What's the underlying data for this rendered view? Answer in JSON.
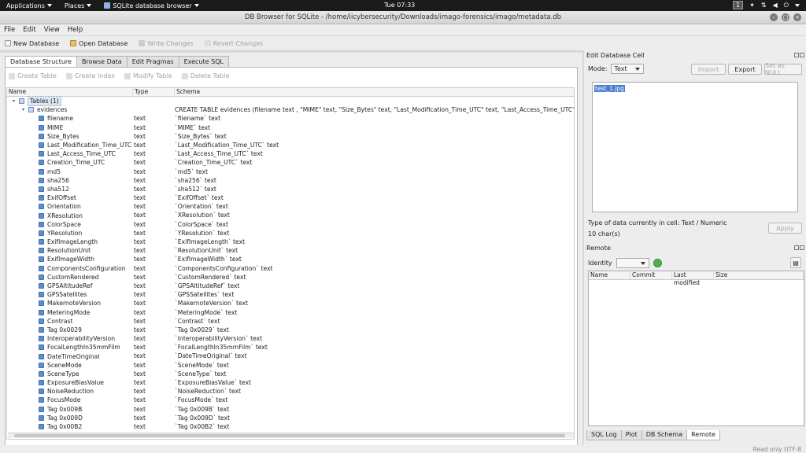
{
  "system_bar": {
    "applications": "Applications",
    "places": "Places",
    "active_app": "SQLite database browser",
    "clock": "Tue 07:33",
    "workspace": "1"
  },
  "window": {
    "title": "DB Browser for SQLite - /home/iicybersecurity/Downloads/imago-forensics/imago/metadata.db"
  },
  "menu": [
    "File",
    "Edit",
    "View",
    "Help"
  ],
  "toolbar": {
    "new_db": "New Database",
    "open_db": "Open Database",
    "write": "Write Changes",
    "revert": "Revert Changes"
  },
  "tabs": [
    "Database Structure",
    "Browse Data",
    "Edit Pragmas",
    "Execute SQL"
  ],
  "structure_toolbar": [
    "Create Table",
    "Create Index",
    "Modify Table",
    "Delete Table"
  ],
  "tree": {
    "headers": [
      "Name",
      "Type",
      "Schema"
    ],
    "tables_node": "Tables (1)",
    "table": {
      "name": "evidences",
      "schema": "CREATE TABLE evidences (filename text , \"MIME\" text, \"Size_Bytes\" text, \"Last_Modification_Time_UTC\" text, \"Last_Access_Time_UTC\" tex"
    },
    "fields": [
      {
        "name": "filename",
        "type": "text",
        "schema": "`filename` text"
      },
      {
        "name": "MIME",
        "type": "text",
        "schema": "`MIME` text"
      },
      {
        "name": "Size_Bytes",
        "type": "text",
        "schema": "`Size_Bytes` text"
      },
      {
        "name": "Last_Modification_Time_UTC",
        "type": "text",
        "schema": "`Last_Modification_Time_UTC` text"
      },
      {
        "name": "Last_Access_Time_UTC",
        "type": "text",
        "schema": "`Last_Access_Time_UTC` text"
      },
      {
        "name": "Creation_Time_UTC",
        "type": "text",
        "schema": "`Creation_Time_UTC` text"
      },
      {
        "name": "md5",
        "type": "text",
        "schema": "`md5` text"
      },
      {
        "name": "sha256",
        "type": "text",
        "schema": "`sha256` text"
      },
      {
        "name": "sha512",
        "type": "text",
        "schema": "`sha512` text"
      },
      {
        "name": "ExifOffset",
        "type": "text",
        "schema": "`ExifOffset` text"
      },
      {
        "name": "Orientation",
        "type": "text",
        "schema": "`Orientation` text"
      },
      {
        "name": "XResolution",
        "type": "text",
        "schema": "`XResolution` text"
      },
      {
        "name": "ColorSpace",
        "type": "text",
        "schema": "`ColorSpace` text"
      },
      {
        "name": "YResolution",
        "type": "text",
        "schema": "`YResolution` text"
      },
      {
        "name": "ExifImageLength",
        "type": "text",
        "schema": "`ExifImageLength` text"
      },
      {
        "name": "ResolutionUnit",
        "type": "text",
        "schema": "`ResolutionUnit` text"
      },
      {
        "name": "ExifImageWidth",
        "type": "text",
        "schema": "`ExifImageWidth` text"
      },
      {
        "name": "ComponentsConfiguration",
        "type": "text",
        "schema": "`ComponentsConfiguration` text"
      },
      {
        "name": "CustomRendered",
        "type": "text",
        "schema": "`CustomRendered` text"
      },
      {
        "name": "GPSAltitudeRef",
        "type": "text",
        "schema": "`GPSAltitudeRef` text"
      },
      {
        "name": "GPSSatellites",
        "type": "text",
        "schema": "`GPSSatellites` text"
      },
      {
        "name": "MakernoteVersion",
        "type": "text",
        "schema": "`MakernoteVersion` text"
      },
      {
        "name": "MeteringMode",
        "type": "text",
        "schema": "`MeteringMode` text"
      },
      {
        "name": "Contrast",
        "type": "text",
        "schema": "`Contrast` text"
      },
      {
        "name": "Tag 0x0029",
        "type": "text",
        "schema": "`Tag 0x0029` text"
      },
      {
        "name": "InteroperabilityVersion",
        "type": "text",
        "schema": "`InteroperabilityVersion` text"
      },
      {
        "name": "FocalLengthIn35mmFilm",
        "type": "text",
        "schema": "`FocalLengthIn35mmFilm` text"
      },
      {
        "name": "DateTimeOriginal",
        "type": "text",
        "schema": "`DateTimeOriginal` text"
      },
      {
        "name": "SceneMode",
        "type": "text",
        "schema": "`SceneMode` text"
      },
      {
        "name": "SceneType",
        "type": "text",
        "schema": "`SceneType` text"
      },
      {
        "name": "ExposureBiasValue",
        "type": "text",
        "schema": "`ExposureBiasValue` text"
      },
      {
        "name": "NoiseReduction",
        "type": "text",
        "schema": "`NoiseReduction` text"
      },
      {
        "name": "FocusMode",
        "type": "text",
        "schema": "`FocusMode` text"
      },
      {
        "name": "Tag 0x009B",
        "type": "text",
        "schema": "`Tag 0x009B` text"
      },
      {
        "name": "Tag 0x009D",
        "type": "text",
        "schema": "`Tag 0x009D` text"
      },
      {
        "name": "Tag 0x00B2",
        "type": "text",
        "schema": "`Tag 0x00B2` text"
      }
    ]
  },
  "edit_cell": {
    "title": "Edit Database Cell",
    "mode_label": "Mode:",
    "mode_value": "Text",
    "import": "Import",
    "export": "Export",
    "set_null": "Set as NULL",
    "value": "test_1.jpg",
    "type_info": "Type of data currently in cell: Text / Numeric",
    "char_count": "10 char(s)",
    "apply": "Apply"
  },
  "remote": {
    "title": "Remote",
    "identity_label": "Identity",
    "headers": [
      "Name",
      "Commit",
      "Last modified",
      "Size"
    ]
  },
  "bottom_tabs": [
    "SQL Log",
    "Plot",
    "DB Schema",
    "Remote"
  ],
  "status": "Read only   UTF-8",
  "colors": {
    "selection": "#4a7ed1",
    "field_icon": "#5b8fd1",
    "green_button": "#4caf50"
  }
}
